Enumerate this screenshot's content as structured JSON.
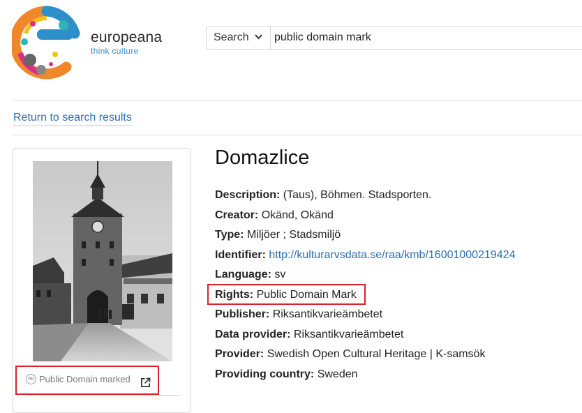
{
  "brand": {
    "name": "europeana",
    "tagline": "think culture",
    "colors": {
      "orange": "#f0882a",
      "blue": "#2f8fc8",
      "magenta": "#d8308a",
      "yellow": "#f4c21e",
      "teal": "#2fb5b5"
    }
  },
  "search": {
    "type_label": "Search",
    "query": "public domain mark"
  },
  "nav": {
    "return_label": "Return to search results"
  },
  "item": {
    "title": "Domazlice",
    "rights_badge_glyph": "PD",
    "rights_badge_label": "Public Domain marked",
    "fields": [
      {
        "label": "Description:",
        "value": "(Taus), Böhmen. Stadsporten."
      },
      {
        "label": "Creator:",
        "value": "Okänd, Okänd"
      },
      {
        "label": "Type:",
        "value": "Miljöer ; Stadsmiljö"
      },
      {
        "label": "Identifier:",
        "value": "http://kulturarvsdata.se/raa/kmb/16001000219424"
      },
      {
        "label": "Language:",
        "value": "sv"
      },
      {
        "label": "Rights:",
        "value": "Public Domain Mark"
      },
      {
        "label": "Publisher:",
        "value": "Riksantikvarieämbetet"
      },
      {
        "label": "Data provider:",
        "value": "Riksantikvarieämbetet"
      },
      {
        "label": "Provider:",
        "value": "Swedish Open Cultural Heritage | K-samsök"
      },
      {
        "label": "Providing country:",
        "value": "Sweden"
      }
    ]
  },
  "ui_colors": {
    "link": "#2a6eb4",
    "highlight": "#d9222a"
  }
}
